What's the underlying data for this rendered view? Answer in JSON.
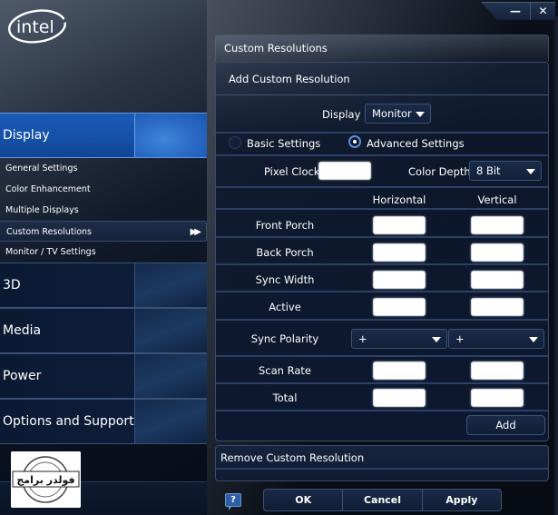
{
  "app": {
    "brand": "intel",
    "window_controls": {
      "minimize": "—",
      "close": "✕"
    }
  },
  "sidebar": {
    "main_items": [
      {
        "label": "Display",
        "active": true
      },
      {
        "label": "3D",
        "active": false
      },
      {
        "label": "Media",
        "active": false
      },
      {
        "label": "Power",
        "active": false
      },
      {
        "label": "Options and Support",
        "active": false
      }
    ],
    "display_sub_items": [
      {
        "label": "General Settings",
        "active": false
      },
      {
        "label": "Color Enhancement",
        "active": false
      },
      {
        "label": "Multiple Displays",
        "active": false
      },
      {
        "label": "Custom Resolutions",
        "active": true,
        "indicator": "▶▶"
      },
      {
        "label": "Monitor / TV Settings",
        "active": false
      }
    ],
    "watermark_text": "فولدر برامج"
  },
  "main": {
    "section_title": "Custom Resolutions",
    "add_panel": {
      "title": "Add Custom Resolution",
      "display_label": "Display",
      "display_value": "Monitor",
      "mode_options": [
        {
          "label": "Basic Settings",
          "selected": false
        },
        {
          "label": "Advanced Settings",
          "selected": true
        }
      ],
      "pixel_clock_label": "Pixel Clock",
      "pixel_clock_value": "",
      "color_depth_label": "Color Depth",
      "color_depth_value": "8 Bit",
      "column_headers": {
        "horizontal": "Horizontal",
        "vertical": "Vertical"
      },
      "timing_rows": [
        {
          "label": "Front Porch",
          "horizontal": "",
          "vertical": ""
        },
        {
          "label": "Back Porch",
          "horizontal": "",
          "vertical": ""
        },
        {
          "label": "Sync Width",
          "horizontal": "",
          "vertical": ""
        },
        {
          "label": "Active",
          "horizontal": "",
          "vertical": ""
        }
      ],
      "sync_polarity": {
        "label": "Sync Polarity",
        "horizontal": "+",
        "vertical": "+"
      },
      "rate_rows": [
        {
          "label": "Scan Rate",
          "horizontal": "",
          "vertical": ""
        },
        {
          "label": "Total",
          "horizontal": "",
          "vertical": ""
        }
      ],
      "add_button": "Add"
    },
    "remove_panel": {
      "title": "Remove Custom Resolution"
    }
  },
  "footer": {
    "help": "?",
    "ok": "OK",
    "cancel": "Cancel",
    "apply": "Apply"
  },
  "colors": {
    "accent_blue": "#1a5ab8",
    "panel_dark": "#0d1830",
    "divider": "#2b4066"
  }
}
